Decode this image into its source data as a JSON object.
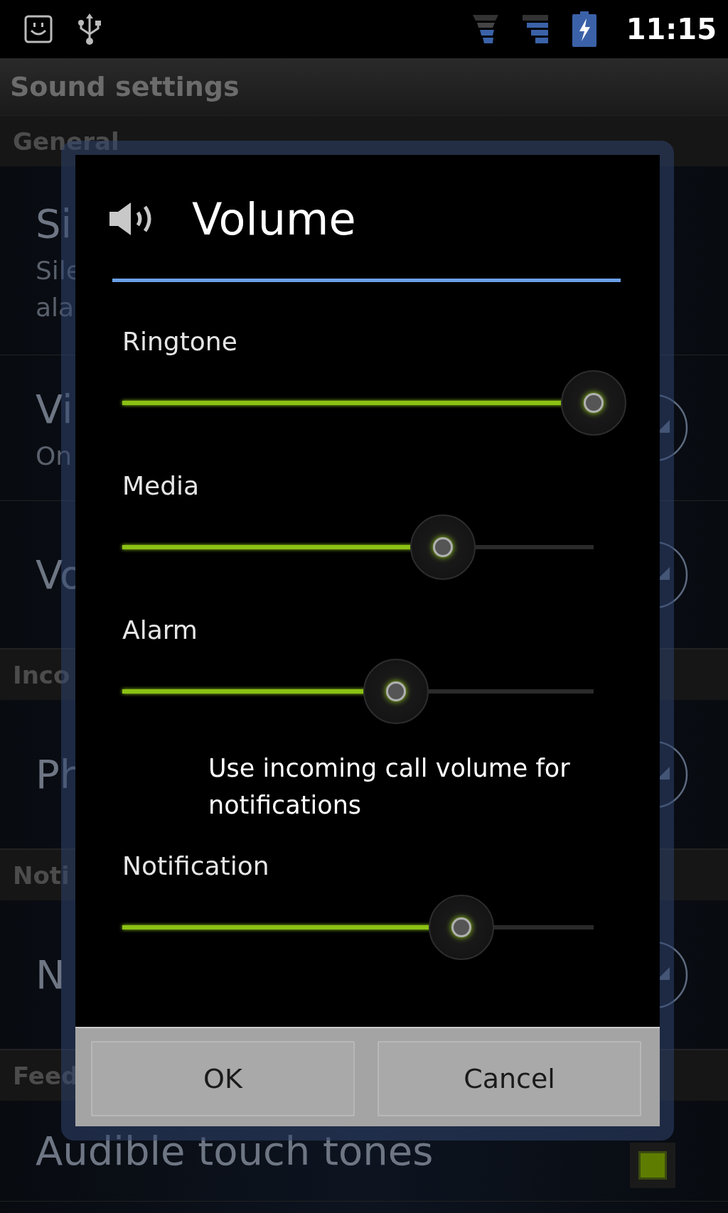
{
  "status_bar": {
    "time": "11:15"
  },
  "screen_title": "Sound settings",
  "sections": [
    {
      "header": "General",
      "rows": [
        {
          "kind": "text",
          "title": "Si",
          "summary_lines": [
            "Sile",
            "ala"
          ]
        },
        {
          "kind": "dropdown",
          "title": "Vi",
          "summary_lines": [
            "On"
          ]
        },
        {
          "kind": "dropdown",
          "title": "Vo"
        }
      ]
    },
    {
      "header": "Inco",
      "rows": [
        {
          "kind": "dropdown",
          "title": "Ph"
        }
      ]
    },
    {
      "header": "Noti",
      "rows": [
        {
          "kind": "dropdown",
          "title": "N"
        }
      ]
    },
    {
      "header": "Feed",
      "rows": [
        {
          "kind": "checkbox",
          "title": "Audible touch tones",
          "checked": true
        }
      ]
    }
  ],
  "dialog": {
    "title": "Volume",
    "items": [
      {
        "kind": "slider",
        "label": "Ringtone",
        "level": 1.0
      },
      {
        "kind": "slider",
        "label": "Media",
        "level": 0.68
      },
      {
        "kind": "slider",
        "label": "Alarm",
        "level": 0.58
      },
      {
        "kind": "note",
        "text": "Use incoming call volume for notifications"
      },
      {
        "kind": "slider",
        "label": "Notification",
        "level": 0.72
      }
    ],
    "buttons": [
      "OK",
      "Cancel"
    ]
  }
}
